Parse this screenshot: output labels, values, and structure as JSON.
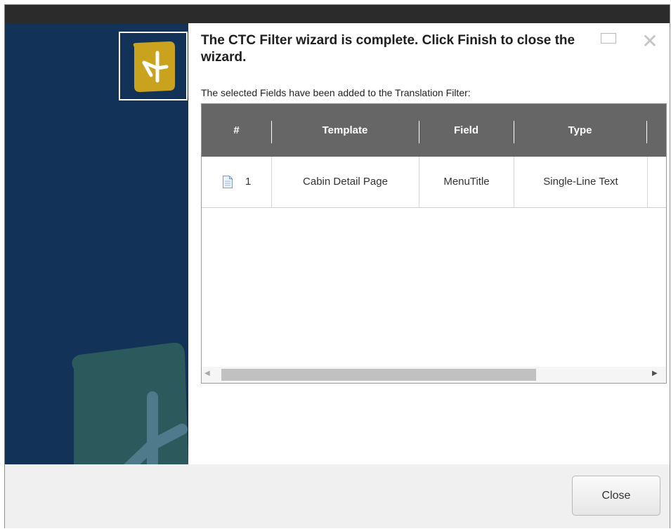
{
  "dialog": {
    "title": "The CTC Filter wizard is complete. Click Finish to close the wizard.",
    "subtitle": "The selected Fields have been added to the Translation Filter:",
    "close_icon": "close-icon",
    "ghost_icon": "window-icon"
  },
  "sidebar": {
    "logo_icon": "app-logo-icon",
    "accent_color": "#c9a21e",
    "background_color": "#133257"
  },
  "grid": {
    "columns": [
      "#",
      "Template",
      "Field",
      "Type"
    ],
    "rows": [
      {
        "icon": "document-icon",
        "number": "1",
        "template": "Cabin Detail Page",
        "field": "MenuTitle",
        "type": "Single-Line Text"
      }
    ],
    "header_color": "#666666"
  },
  "footer": {
    "close_label": "Close"
  }
}
